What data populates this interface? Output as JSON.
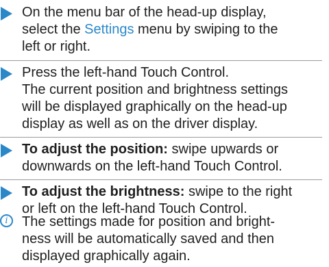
{
  "steps": [
    {
      "type": "action",
      "lines": [
        {
          "before": "On the menu bar of the head-up display,"
        },
        {
          "before": "select the ",
          "highlight": "Settings",
          "after": " menu by swiping to the"
        },
        {
          "before": "left or right."
        }
      ]
    },
    {
      "type": "action",
      "lines": [
        {
          "before": "Press the left-hand Touch Control."
        },
        {
          "before": "The current position and brightness settings"
        },
        {
          "before": "will be displayed graphically on the head-up"
        },
        {
          "before": "display as well as on the driver display."
        }
      ]
    },
    {
      "type": "action",
      "lines": [
        {
          "bold": "To adjust the position:",
          "after": " swipe upwards or"
        },
        {
          "before": "downwards on the left-hand Touch Control."
        }
      ]
    },
    {
      "type": "action",
      "lines": [
        {
          "bold": "To adjust the brightness:",
          "after": " swipe to the right"
        },
        {
          "before": "or left on the left-hand Touch Control."
        }
      ]
    },
    {
      "type": "info",
      "icon_glyph": "i",
      "lines": [
        {
          "before": "The settings made for position and bright-"
        },
        {
          "before": "ness will be automatically saved and then"
        },
        {
          "before": "displayed graphically again."
        }
      ]
    }
  ],
  "colors": {
    "accent": "#2a87c8",
    "text": "#1e1e1e",
    "separator": "#9a9a9a"
  },
  "icons": {
    "action": "right-triangle-arrow-icon",
    "info": "info-circle-icon"
  }
}
